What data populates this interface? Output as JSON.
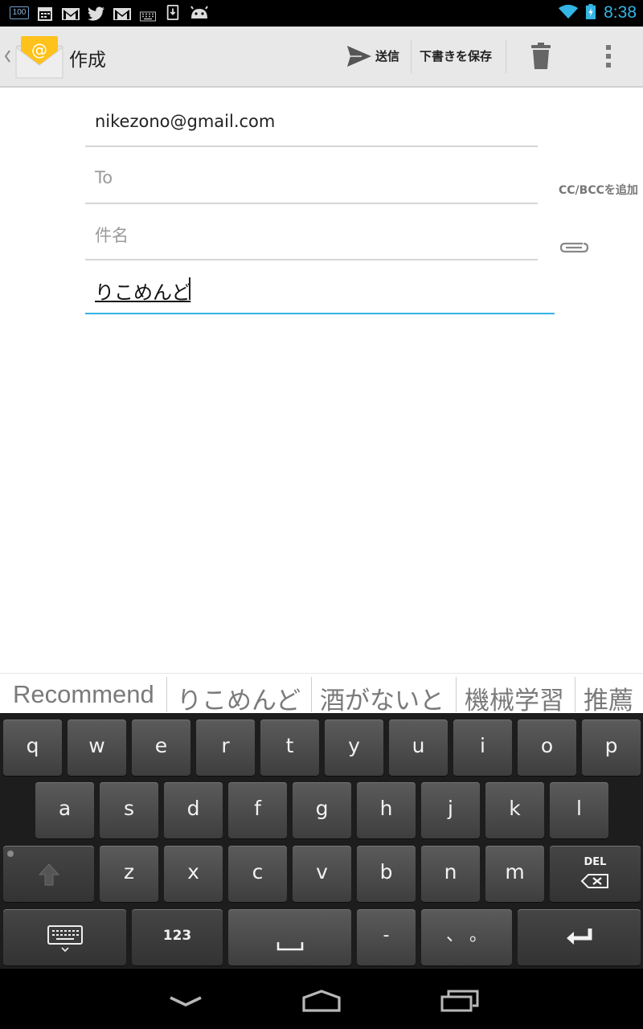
{
  "status_bar": {
    "time": "8:38",
    "battery_icon_text": "100",
    "icons": [
      "battery-100-icon",
      "calendar-icon",
      "gmail-icon",
      "twitter-icon",
      "gmail-icon",
      "keyboard-icon",
      "download-icon",
      "android-icon",
      "wifi-icon",
      "battery-charging-icon"
    ],
    "accent_color": "#33b5e5"
  },
  "action_bar": {
    "title": "作成",
    "send_label": "送信",
    "save_draft_label": "下書きを保存"
  },
  "compose": {
    "from": "nikezono@gmail.com",
    "to_placeholder": "To",
    "cc_bcc_label": "CC/BCCを追加",
    "subject_placeholder": "件名",
    "body_text": "りこめんど"
  },
  "suggestions": [
    "Recommend",
    "りこめんど",
    "酒がないと",
    "機械学習",
    "推薦"
  ],
  "keyboard": {
    "row1": [
      "q",
      "w",
      "e",
      "r",
      "t",
      "y",
      "u",
      "i",
      "o",
      "p"
    ],
    "row2": [
      "a",
      "s",
      "d",
      "f",
      "g",
      "h",
      "j",
      "k",
      "l"
    ],
    "row3": [
      "z",
      "x",
      "c",
      "v",
      "b",
      "n",
      "m"
    ],
    "del_label": "DEL",
    "numbers_label": "123",
    "dash_label": "-",
    "punct_label": "、 。"
  }
}
